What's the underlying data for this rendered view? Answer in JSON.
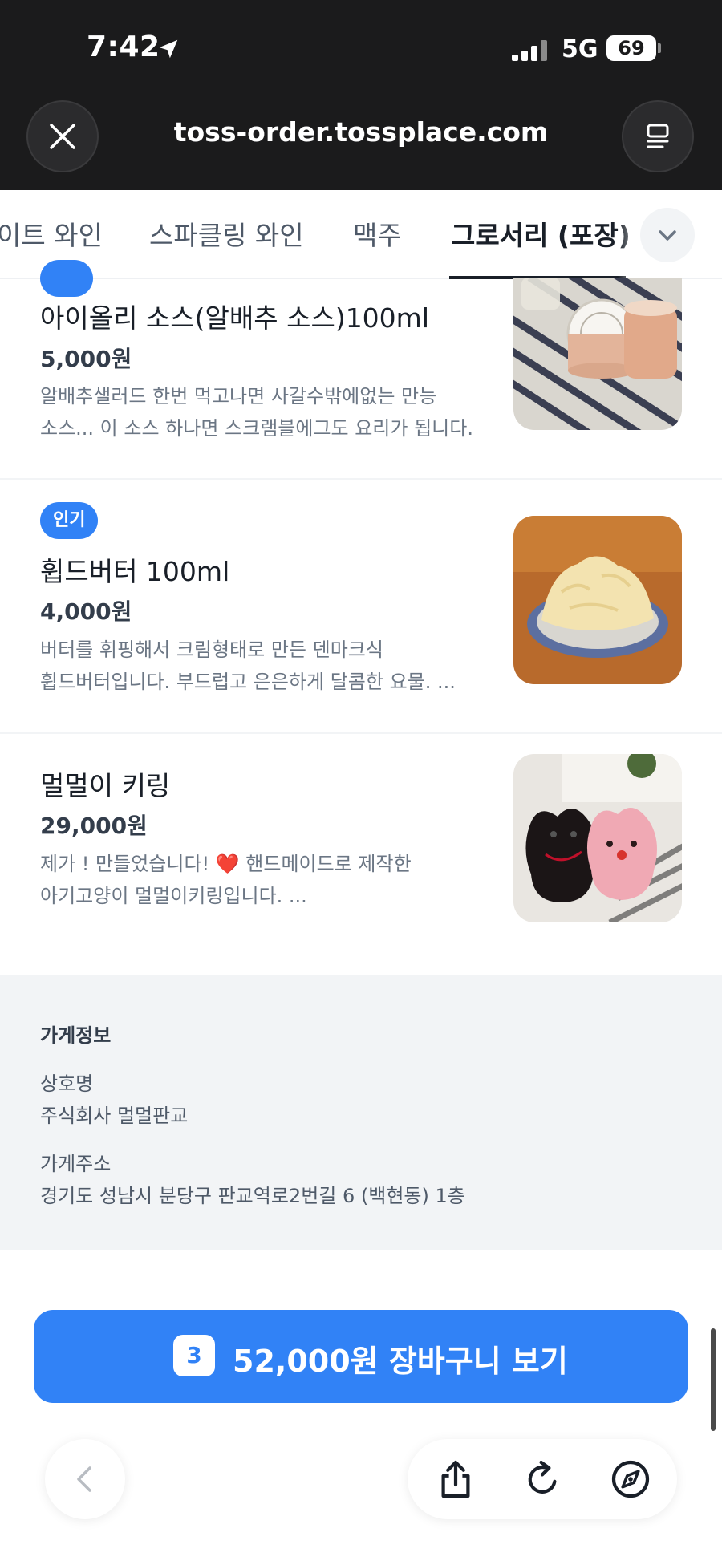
{
  "status_bar": {
    "time": "7:42",
    "network": "5G",
    "battery": "69"
  },
  "browser": {
    "url": "toss-order.tossplace.com"
  },
  "tabs": [
    {
      "label": "이트 와인"
    },
    {
      "label": "스파클링 와인"
    },
    {
      "label": "맥주"
    },
    {
      "label": "그로서리 (포장)",
      "active": true
    }
  ],
  "items": [
    {
      "name": "아이올리 소스(알배추 소스)100ml",
      "price": "5,000원",
      "desc_line1": "알배추샐러드 한번 먹고나면 사갈수밖에없는 만능",
      "desc_line2": "소스... 이 소스 하나면 스크램블에그도 요리가 됩니다."
    },
    {
      "badge": "인기",
      "name": "휩드버터 100ml",
      "price": "4,000원",
      "desc_line1": "버터를 휘핑해서 크림형태로 만든 덴마크식",
      "desc_line2": "휩드버터입니다. 부드럽고 은은하게 달콤한 요물. ..."
    },
    {
      "name": "멀멀이 키링",
      "price": "29,000원",
      "desc_line1_a": "제가 ! 만들었습니다! ",
      "desc_line1_emoji": "❤️",
      "desc_line1_b": " 핸드메이드로 제작한",
      "desc_line2": "아기고양이 멀멀이키링입니다. ..."
    }
  ],
  "store_info": {
    "title": "가게정보",
    "name_label": "상호명",
    "name_value": "주식회사 멀멀판교",
    "address_label": "가게주소",
    "address_value": "경기도 성남시 분당구 판교역로2번길 6 (백현동) 1층"
  },
  "cart": {
    "count": "3",
    "label": "52,000원 장바구니 보기"
  },
  "colors": {
    "accent": "#3182f6",
    "header_bg": "#1b1b1c",
    "info_bg": "#f2f4f6"
  },
  "icons": [
    "location-arrow-icon",
    "signal-icon",
    "close-icon",
    "tabs-icon",
    "chevron-down-icon",
    "back-icon",
    "share-icon",
    "reload-icon",
    "compass-icon"
  ]
}
